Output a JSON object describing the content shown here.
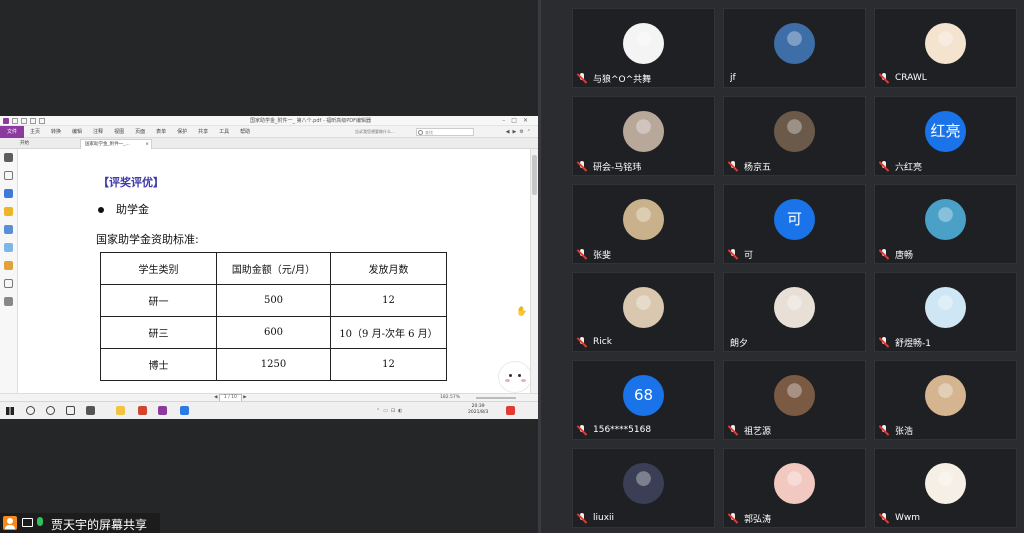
{
  "shared_screen": {
    "window_title": "国家助学金_附件一_ 第八个.pdf - 福昕高级PDF编辑器",
    "file_tab": "文件",
    "menus": [
      "主页",
      "转换",
      "编辑",
      "注释",
      "视图",
      "页面",
      "表单",
      "保护",
      "共享",
      "工具",
      "帮助"
    ],
    "search_hint": "告诉我您想要做什么...",
    "search_placeholder": "查找",
    "tabs": [
      "开始",
      "国家助学金_附件一_..."
    ],
    "doc": {
      "section_title": "【评奖评优】",
      "bullet": "助学金",
      "standard_label": "国家助学金资助标准:",
      "table": {
        "headers": [
          "学生类别",
          "国助金额（元/月）",
          "发放月数"
        ],
        "rows": [
          [
            "研一",
            "500",
            "12"
          ],
          [
            "研三",
            "600",
            "10（9 月-次年 6 月）"
          ],
          [
            "博士",
            "1250",
            "12"
          ]
        ]
      }
    },
    "status": {
      "page": "1 / 10",
      "zoom": "182.57%"
    },
    "clock": {
      "time": "20:39",
      "date": "2021/8/3"
    },
    "presenter_label": "贾天宇的屏幕共享"
  },
  "participants": [
    {
      "name": "与狼^O^共舞",
      "muted": true,
      "avatar_text": "",
      "avatar_color": "#f4f4f4"
    },
    {
      "name": "jf",
      "muted": false,
      "avatar_text": "",
      "avatar_color": "#3e6ea8"
    },
    {
      "name": "CRAWL",
      "muted": true,
      "avatar_text": "",
      "avatar_color": "#f3e3cf"
    },
    {
      "name": "研会-马铭玮",
      "muted": true,
      "avatar_text": "",
      "avatar_color": "#b7a89a"
    },
    {
      "name": "杨京五",
      "muted": true,
      "avatar_text": "",
      "avatar_color": "#6b5a4a"
    },
    {
      "name": "六红亮",
      "muted": true,
      "avatar_text": "红亮",
      "avatar_color": "#1a73e8"
    },
    {
      "name": "张斐",
      "muted": true,
      "avatar_text": "",
      "avatar_color": "#c9b28b"
    },
    {
      "name": "可",
      "muted": true,
      "avatar_text": "可",
      "avatar_color": "#1a73e8"
    },
    {
      "name": "唐畅",
      "muted": true,
      "avatar_text": "",
      "avatar_color": "#4ba0c8"
    },
    {
      "name": "Rick",
      "muted": true,
      "avatar_text": "",
      "avatar_color": "#d9c7b0"
    },
    {
      "name": "朗夕",
      "muted": false,
      "avatar_text": "",
      "avatar_color": "#e8e0d6"
    },
    {
      "name": "舒煜畅-1",
      "muted": true,
      "avatar_text": "",
      "avatar_color": "#cfe7f5"
    },
    {
      "name": "156****5168",
      "muted": true,
      "avatar_text": "68",
      "avatar_color": "#1a73e8"
    },
    {
      "name": "祖艺源",
      "muted": true,
      "avatar_text": "",
      "avatar_color": "#7b5a44"
    },
    {
      "name": "张浩",
      "muted": true,
      "avatar_text": "",
      "avatar_color": "#d4b58f"
    },
    {
      "name": "liuxii",
      "muted": true,
      "avatar_text": "",
      "avatar_color": "#3a3f55"
    },
    {
      "name": "郭弘涛",
      "muted": true,
      "avatar_text": "",
      "avatar_color": "#f1c9c1"
    },
    {
      "name": "Wwm",
      "muted": true,
      "avatar_text": "",
      "avatar_color": "#f6efe6"
    }
  ]
}
